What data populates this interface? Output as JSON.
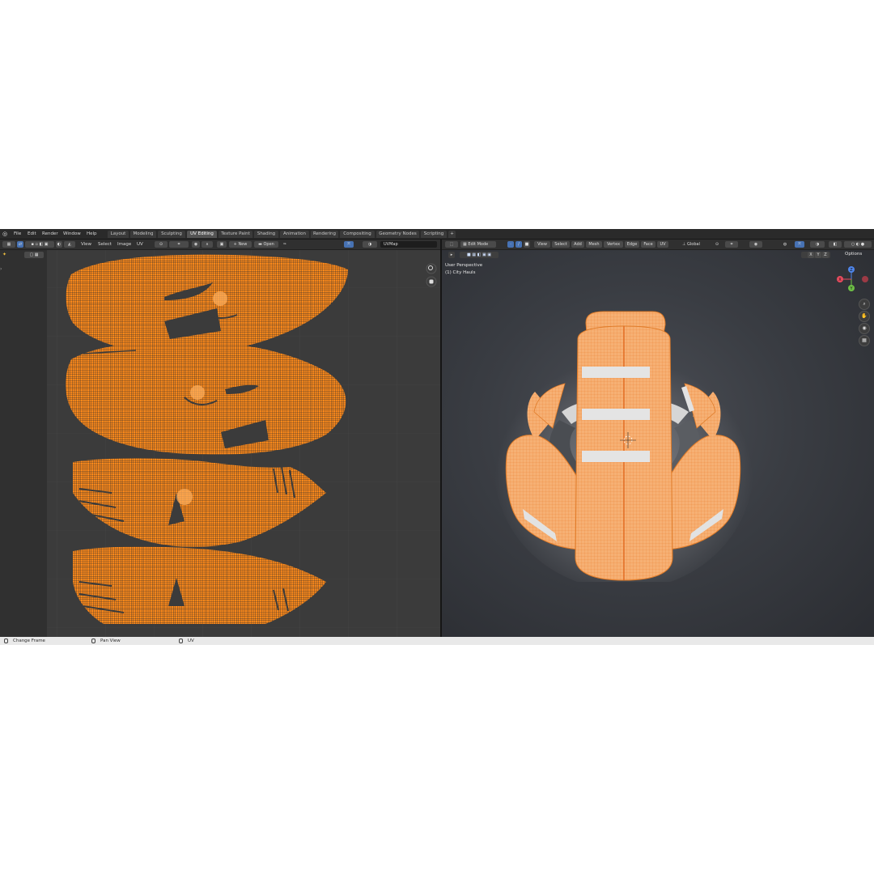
{
  "menu": [
    "File",
    "Edit",
    "Render",
    "Window",
    "Help"
  ],
  "workspace_tabs": [
    "Layout",
    "Modeling",
    "Sculpting",
    "UV Editing",
    "Texture Paint",
    "Shading",
    "Animation",
    "Rendering",
    "Compositing",
    "Geometry Nodes",
    "Scripting"
  ],
  "active_tab": "UV Editing",
  "add_tab": "+",
  "uv_header": {
    "view": "View",
    "select": "Select",
    "image": "Image",
    "uv": "UV",
    "new": "New",
    "new_plus": "+",
    "open": "Open",
    "uvmap": "UVMap"
  },
  "viewport_header": {
    "mode": "Edit Mode",
    "view": "View",
    "select": "Select",
    "add": "Add",
    "mesh": "Mesh",
    "vertex": "Vertex",
    "edge": "Edge",
    "face": "Face",
    "uv": "UV",
    "orientation": "Global",
    "options": "Options",
    "x": "X",
    "y": "Y",
    "z": "Z"
  },
  "viewport_overlay": {
    "perspective": "User Perspective",
    "object": "(1) City Hauls"
  },
  "gizmo": {
    "z": "Z",
    "y": "Y",
    "x": "X"
  },
  "status": {
    "change_frame": "Change Frame",
    "pan_view": "Pan View",
    "uv": "UV"
  },
  "colors": {
    "accent_blue": "#4772b3",
    "uv_orange": "#ff8a1a",
    "mesh_orange": "#f5a35a"
  }
}
